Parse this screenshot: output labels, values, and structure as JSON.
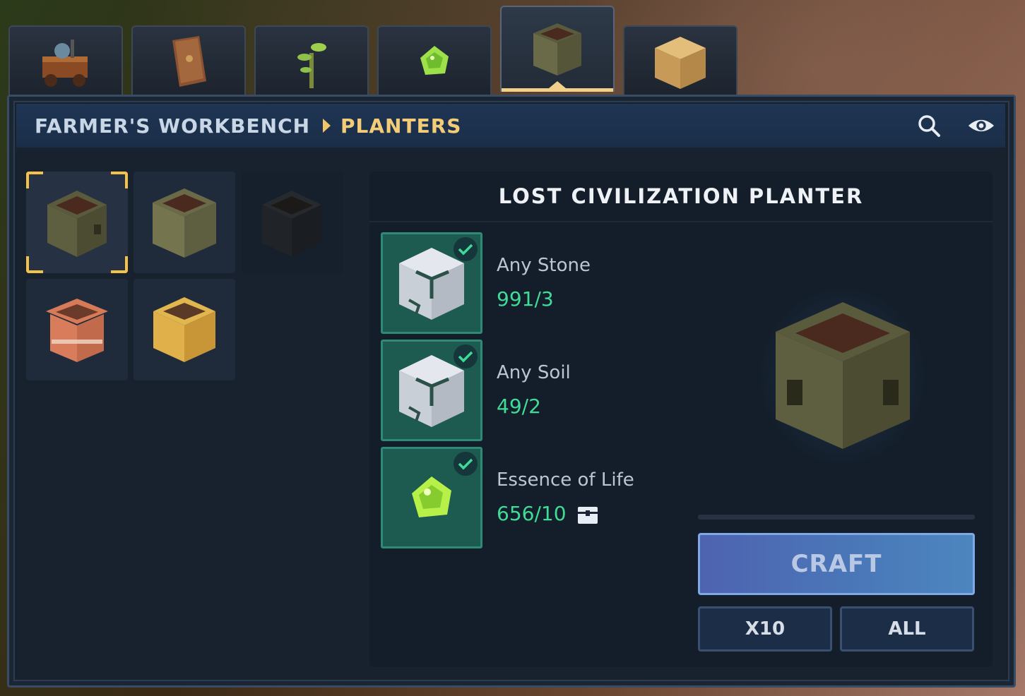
{
  "tabs": [
    {
      "icon": "workbench-cart-icon"
    },
    {
      "icon": "book-icon"
    },
    {
      "icon": "sapling-icon"
    },
    {
      "icon": "essence-gem-icon"
    },
    {
      "icon": "planter-icon",
      "active": true
    },
    {
      "icon": "hay-block-icon"
    }
  ],
  "header": {
    "root": "FARMER'S WORKBENCH",
    "current": "PLANTERS",
    "search_icon": "search-icon",
    "visibility_icon": "eye-icon"
  },
  "items": [
    {
      "name": "lost-civilization-planter",
      "selected": true
    },
    {
      "name": "stone-brick-planter"
    },
    {
      "name": "dark-planter",
      "dim": true
    },
    {
      "name": "clay-planter"
    },
    {
      "name": "hay-planter"
    }
  ],
  "recipe": {
    "title": "LOST CIVILIZATION PLANTER",
    "ingredients": [
      {
        "name": "Any Stone",
        "count": "991/3",
        "icon": "stone-cube-icon",
        "ok": true
      },
      {
        "name": "Any Soil",
        "count": "49/2",
        "icon": "stone-cube-icon",
        "ok": true
      },
      {
        "name": "Essence of Life",
        "count": "656/10",
        "icon": "essence-gem-icon",
        "ok": true,
        "storage_icon": "chest-icon"
      }
    ],
    "progress": 0,
    "craft_label": "CRAFT",
    "x10_label": "X10",
    "all_label": "ALL"
  },
  "colors": {
    "accent_gold": "#f2cc76",
    "count_green": "#3fdc98",
    "craft_blue": "#4a78b8"
  }
}
